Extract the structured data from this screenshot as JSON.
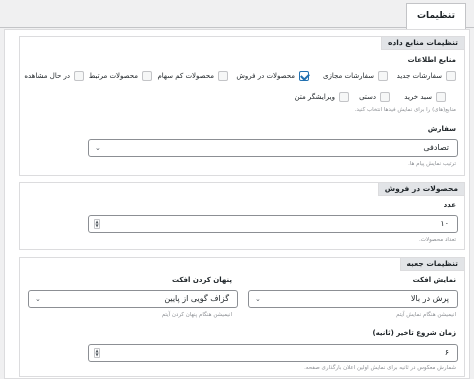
{
  "tab": {
    "label": "تنظیمات"
  },
  "data_source": {
    "title": "تنظیمات منابع داده",
    "sources_label": "منابع اطلاعات",
    "options": [
      {
        "label": "سفارشات جدید",
        "checked": false
      },
      {
        "label": "سفارشات مجازی",
        "checked": false
      },
      {
        "label": "محصولات در فروش",
        "checked": true
      },
      {
        "label": "محصولات کم سهام",
        "checked": false
      },
      {
        "label": "محصولات مرتبط",
        "checked": false
      },
      {
        "label": "در حال مشاهده",
        "checked": false
      },
      {
        "label": "سبد خرید",
        "checked": false
      },
      {
        "label": "دستی",
        "checked": false
      },
      {
        "label": "ویرایشگر متن",
        "checked": false
      }
    ],
    "sources_hint": "منابع(های) را برای نمایش فیدها انتخاب کنید.",
    "order_label": "سفارش",
    "order_value": "تصادفی",
    "order_hint": "ترتیب نمایش پیام ها."
  },
  "products_on_sale": {
    "title": "محصولات در فروش",
    "count_label": "عدد",
    "count_value": "۱۰",
    "count_hint": "تعداد محصولات."
  },
  "popup_settings": {
    "title": "تنظیمات جعبه",
    "show_effect_label": "نمایش افکت",
    "show_effect_value": "پرش در بالا",
    "show_effect_hint": "انیمیشن هنگام نمایش آیتم",
    "hide_effect_label": "پنهان کردن افکت",
    "hide_effect_value": "گزاف گویی از پایین",
    "hide_effect_hint": "انیمیشن هنگام پنهان کردن آیتم",
    "start_delay_label": "زمان شروع تاخیر (ثانیه)",
    "start_delay_value": "۶",
    "start_delay_hint": "شمارش معکوس در ثانیه برای نمایش اولین اعلان بارگذاری صفحه."
  }
}
